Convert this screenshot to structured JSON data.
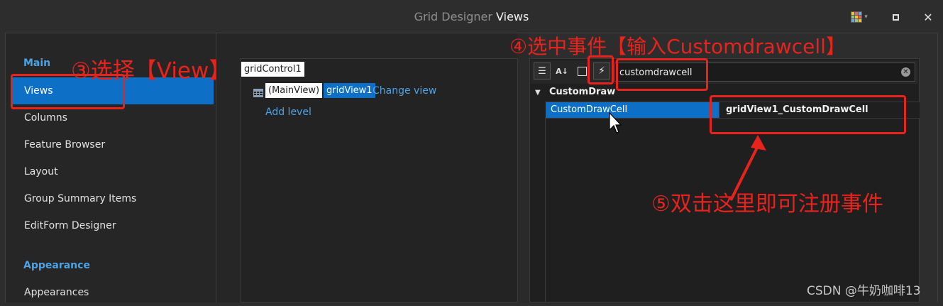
{
  "window": {
    "title_prefix": "Grid Designer",
    "title_main": "Views"
  },
  "nav": {
    "groups": [
      {
        "label": "Main"
      },
      {
        "label": "Appearance"
      }
    ],
    "items": [
      {
        "label": "Views",
        "selected": true
      },
      {
        "label": "Columns"
      },
      {
        "label": "Feature Browser"
      },
      {
        "label": "Layout"
      },
      {
        "label": "Group Summary Items"
      },
      {
        "label": "EditForm Designer"
      },
      {
        "label": "Appearances"
      }
    ]
  },
  "tree": {
    "root": "gridControl1",
    "level_name": "(MainView)",
    "view_name": "gridView1",
    "change_view": "Change view",
    "add_level": "Add level"
  },
  "properties": {
    "search": {
      "value": "customdrawcell",
      "placeholder": ""
    },
    "category": "CustomDraw",
    "event": {
      "name": "CustomDrawCell",
      "handler": "gridView1_CustomDrawCell"
    }
  },
  "annotations": {
    "step3": "③选择【View】",
    "step4": "④选中事件【输入Customdrawcell】",
    "step5": "⑤双击这里即可注册事件",
    "color": "#e8231d"
  },
  "watermark": "CSDN @牛奶咖啡13"
}
